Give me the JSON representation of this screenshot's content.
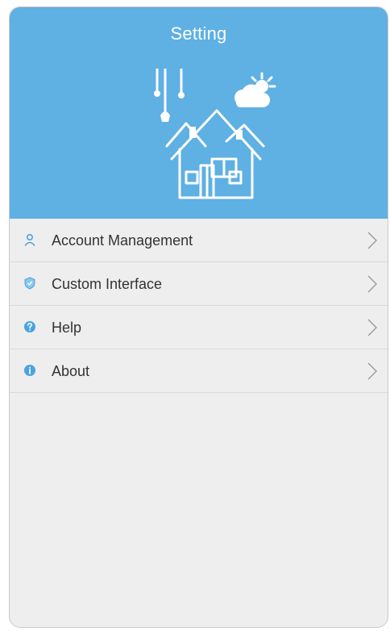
{
  "header": {
    "title": "Setting",
    "background_color": "#5fb0e3",
    "illustration_icon": "smart-house-icon"
  },
  "menu": {
    "items": [
      {
        "label": "Account Management",
        "icon": "person-icon"
      },
      {
        "label": "Custom Interface",
        "icon": "shield-icon"
      },
      {
        "label": "Help",
        "icon": "question-circle-icon"
      },
      {
        "label": "About",
        "icon": "info-circle-icon"
      }
    ],
    "accent_color": "#4aa3df",
    "chevron_icon": "chevron-right-icon"
  }
}
